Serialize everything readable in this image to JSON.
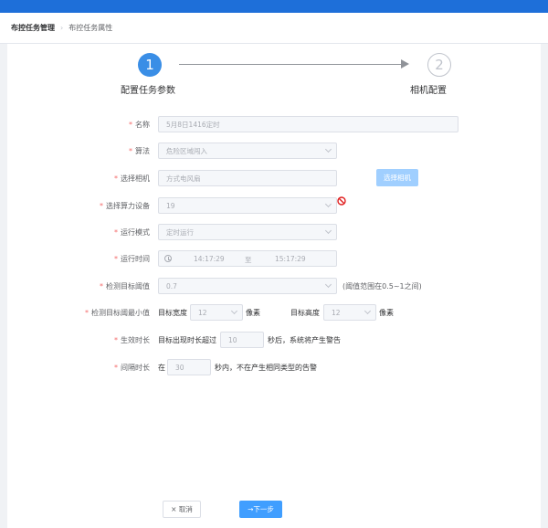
{
  "breadcrumb": {
    "root": "布控任务管理",
    "current": "布控任务属性"
  },
  "steps": [
    {
      "number": "1",
      "title": "配置任务参数"
    },
    {
      "number": "2",
      "title": "相机配置"
    }
  ],
  "form": {
    "name": {
      "label": "名称",
      "placeholder": "5月8日1416定时"
    },
    "algorithm": {
      "label": "算法",
      "value": "危险区域闯入"
    },
    "camera": {
      "label": "选择相机",
      "placeholder": "方式电风扇",
      "button": "选择相机"
    },
    "compute": {
      "label": "选择算力设备",
      "value": "19"
    },
    "mode": {
      "label": "运行模式",
      "value": "定时运行"
    },
    "time": {
      "label": "运行时间",
      "start": "14:17:29",
      "sep": "至",
      "end": "15:17:29"
    },
    "threshold": {
      "label": "检测目标阈值",
      "value": "0.7",
      "hint": "(阈值范围在0.5~1之间)"
    },
    "min_size": {
      "label": "检测目标阈最小值",
      "width_label": "目标宽度",
      "width_value": "12",
      "width_unit": "像素",
      "height_label": "目标高度",
      "height_value": "12",
      "height_unit": "像素"
    },
    "duration": {
      "label": "生效时长",
      "prefix": "目标出现时长超过",
      "value": "10",
      "suffix": "秒后，系统将产生警告"
    },
    "interval": {
      "label": "间隔时长",
      "prefix": "在",
      "value": "30",
      "suffix": "秒内，不在产生相同类型的告警"
    }
  },
  "footer": {
    "cancel": "× 取消",
    "next": "→下一步"
  },
  "colors": {
    "primary": "#409eff",
    "required": "#f56c6c",
    "topbar": "#1e6fd9"
  },
  "icons": {
    "forbidden": "forbidden-icon",
    "clock": "clock-icon"
  }
}
